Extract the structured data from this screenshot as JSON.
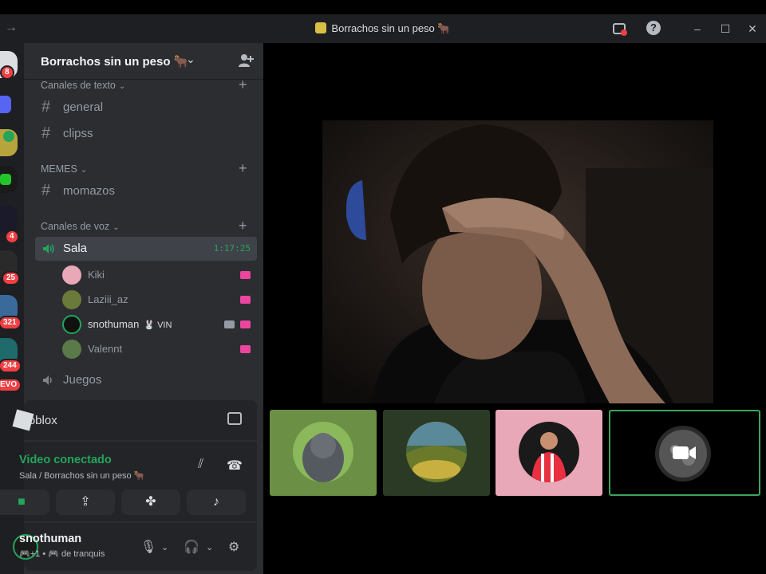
{
  "window": {
    "title": "Borrachos sin un peso 🐂",
    "back_glyph": "→"
  },
  "rail": {
    "badges": [
      "8",
      "4",
      "25",
      "321",
      "244",
      "EVO"
    ]
  },
  "guild": {
    "name": "Borrachos sin un peso 🐂"
  },
  "categories": {
    "text": "Canales de texto",
    "memes": "MEMES",
    "voice": "Canales de voz"
  },
  "channels": {
    "general": "general",
    "clipss": "clipss",
    "momazos": "momazos",
    "sala": "Sala",
    "sala_timer": "1:17:25",
    "juegos": "Juegos"
  },
  "voice_users": [
    {
      "name": "Kiki"
    },
    {
      "name": "Laziii_az"
    },
    {
      "name": "snothuman",
      "tag": "🐰 VIN"
    },
    {
      "name": "Valennt"
    }
  ],
  "activity": {
    "name": "Roblox"
  },
  "rtc": {
    "status": "Video conectado",
    "location": "Sala / Borrachos sin un peso 🐂"
  },
  "user": {
    "name": "snothuman",
    "status": "🎮+1 • 🎮 de tranquis"
  },
  "colors": {
    "green": "#23a55a",
    "pink": "#eb459e",
    "red": "#f23f43",
    "tile1_bg": "#6a8f45",
    "tile2_bg": "#2b3a24",
    "tile3_bg": "#e8a8b8"
  }
}
